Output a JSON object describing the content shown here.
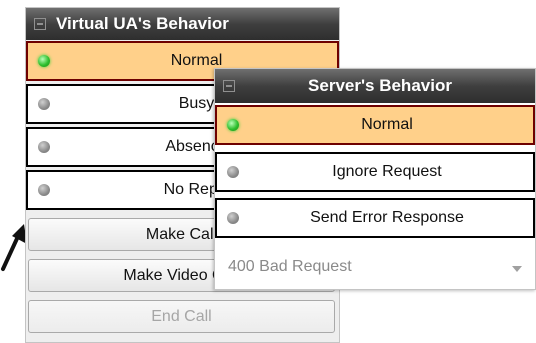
{
  "virtual_ua": {
    "title": "Virtual UA's Behavior",
    "options": [
      {
        "label": "Normal",
        "selected": true
      },
      {
        "label": "Busy",
        "selected": false
      },
      {
        "label": "Absence",
        "selected": false
      },
      {
        "label": "No Reply",
        "selected": false
      }
    ],
    "buttons": {
      "make_call": "Make Call",
      "make_video_call": "Make Video Call",
      "end_call": "End Call"
    }
  },
  "server": {
    "title": "Server's Behavior",
    "options": [
      {
        "label": "Normal",
        "selected": true
      },
      {
        "label": "Ignore Request",
        "selected": false
      },
      {
        "label": "Send Error Response",
        "selected": false
      }
    ],
    "error_response_select": {
      "value": "400 Bad Request"
    }
  },
  "colors": {
    "selected_fill": "#ffd08a",
    "selected_border": "#6e0000",
    "active_radio": "#2fbf2f",
    "title_bar": "#3f3f3f"
  },
  "icons": {
    "collapse": "collapse-icon",
    "radio_on": "radio-on-icon",
    "radio_off": "radio-off-icon",
    "dropdown": "chevron-down-icon",
    "pointer": "arrow-pointer-icon"
  }
}
